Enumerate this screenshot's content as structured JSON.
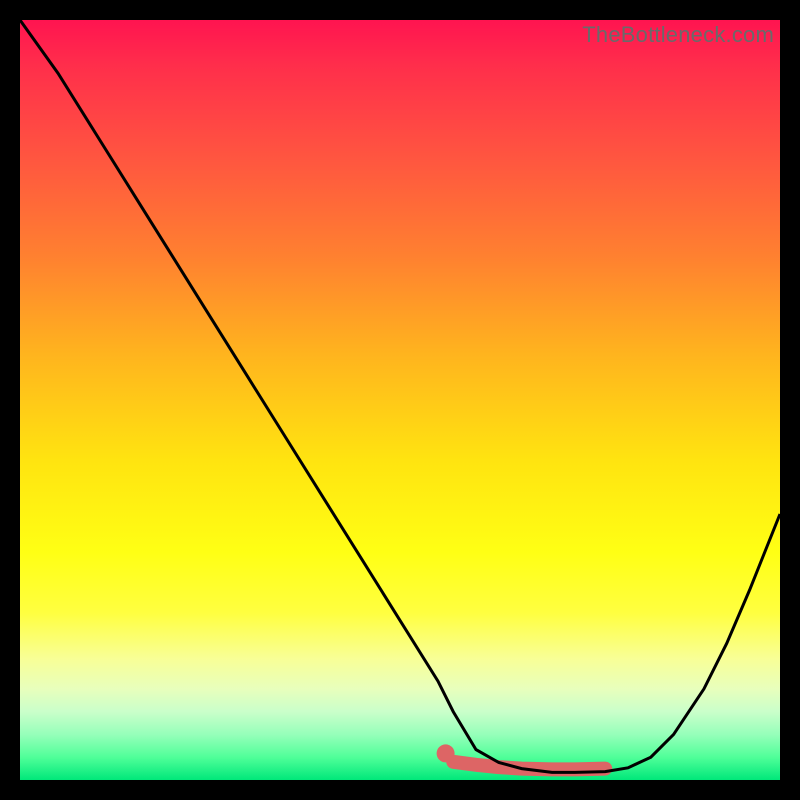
{
  "watermark": "TheBottleneck.com",
  "chart_data": {
    "type": "line",
    "title": "",
    "xlabel": "",
    "ylabel": "",
    "xlim": [
      0,
      100
    ],
    "ylim": [
      0,
      100
    ],
    "series": [
      {
        "name": "bottleneck-curve",
        "x": [
          0,
          5,
          10,
          15,
          20,
          25,
          30,
          35,
          40,
          45,
          50,
          55,
          57,
          60,
          63,
          66,
          70,
          73,
          77,
          80,
          83,
          86,
          90,
          93,
          96,
          100
        ],
        "y": [
          100,
          93,
          85,
          77,
          69,
          61,
          53,
          45,
          37,
          29,
          21,
          13,
          9,
          4,
          2.3,
          1.5,
          1.0,
          1.0,
          1.1,
          1.6,
          3,
          6,
          12,
          18,
          25,
          35
        ]
      }
    ],
    "highlight": {
      "name": "optimal-range",
      "x": [
        57,
        60,
        63,
        66,
        70,
        73,
        77
      ],
      "y": [
        2.4,
        2.0,
        1.7,
        1.5,
        1.4,
        1.4,
        1.5
      ]
    },
    "marker": {
      "x": 56,
      "y": 3.5
    },
    "colors": {
      "curve": "#000000",
      "highlight": "#dd6565",
      "gradient_top": "#ff1450",
      "gradient_mid": "#ffe410",
      "gradient_bottom": "#00e87a",
      "frame": "#000000"
    }
  }
}
